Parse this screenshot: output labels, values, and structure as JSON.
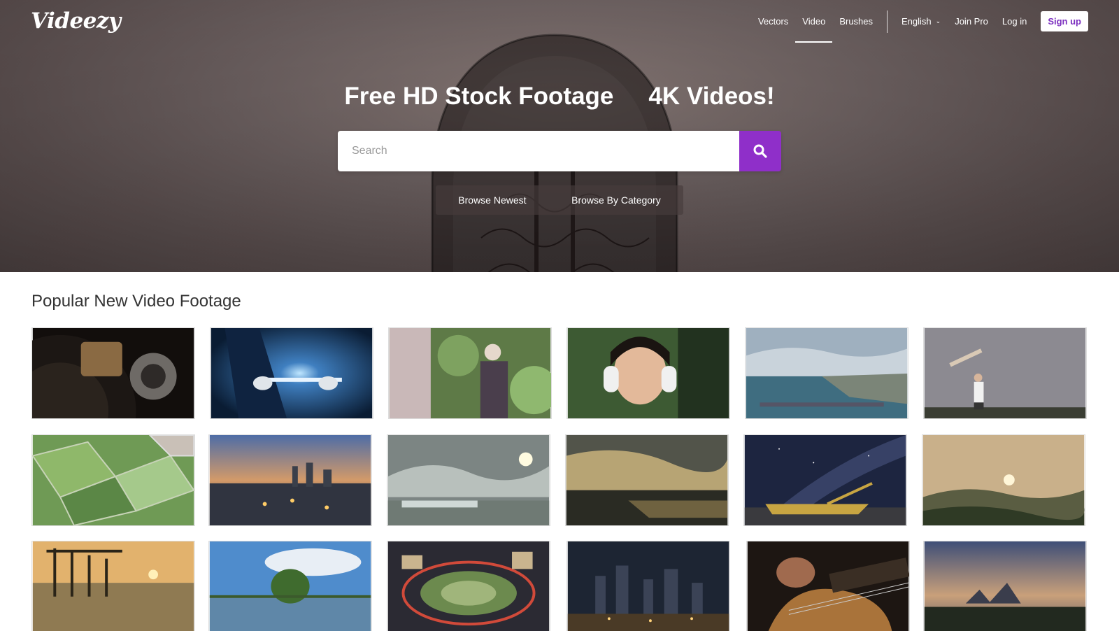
{
  "brand": {
    "logo": "Videezy"
  },
  "nav": {
    "items": [
      "Vectors",
      "Video",
      "Brushes"
    ],
    "active": "Video",
    "language": "English",
    "join_pro": "Join Pro",
    "login": "Log in",
    "signup": "Sign up"
  },
  "hero": {
    "title_left": "Free HD Stock Footage",
    "title_right": "4K Videos!",
    "search_placeholder": "Search",
    "browse_newest": "Browse Newest",
    "browse_category": "Browse By Category"
  },
  "section": {
    "title": "Popular New Video Footage"
  },
  "colors": {
    "accent": "#8f2fc9",
    "signup_text": "#7b2fbf"
  },
  "thumbnails": [
    "vinyl-record-player",
    "hands-holding-tablet-glow",
    "woman-in-garden",
    "girl-with-headphones",
    "coastal-city-bay",
    "man-with-model-plane",
    "aerial-green-fields",
    "city-skyline-dusk",
    "sun-over-marsh-clouds",
    "sunset-over-river",
    "milky-way-over-boat",
    "misty-mountain-sunrise",
    "pier-at-sunset",
    "tree-island-in-lake",
    "roundabout-night-traffic",
    "city-skyline-night",
    "acoustic-guitar-closeup",
    "sunrise-over-islands"
  ]
}
